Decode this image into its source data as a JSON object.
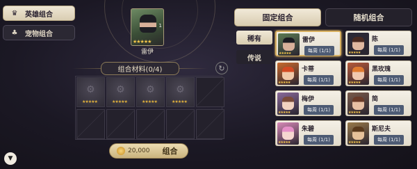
{
  "sidebar": {
    "items": [
      {
        "label": "英雄组合",
        "icon": "crown-icon",
        "glyph": "♛"
      },
      {
        "label": "宠物组合",
        "icon": "paw-icon",
        "glyph": "♣"
      }
    ]
  },
  "filter": {
    "icon": "filter-icon",
    "glyph": "▼"
  },
  "center": {
    "hero": {
      "name": "雷伊",
      "level": "1"
    },
    "materials_label": "组合材料(0/4)",
    "refresh_glyph": "↻",
    "slots": [
      {
        "state": "filled"
      },
      {
        "state": "filled"
      },
      {
        "state": "filled"
      },
      {
        "state": "filled"
      },
      {
        "state": "empty"
      },
      {
        "state": "empty"
      },
      {
        "state": "empty"
      },
      {
        "state": "empty"
      },
      {
        "state": "empty"
      },
      {
        "state": "empty"
      }
    ],
    "cost": "20,000",
    "combine_label": "组合"
  },
  "right": {
    "tabs": [
      {
        "label": "固定组合",
        "active": true
      },
      {
        "label": "随机组合",
        "active": false
      }
    ],
    "rarities": [
      {
        "label": "稀有",
        "active": true
      },
      {
        "label": "传说",
        "active": false
      }
    ],
    "heroes": [
      {
        "name": "雷伊",
        "badge": "每周 (1/1)",
        "selected": true,
        "bg": "#5c7a52",
        "skin": "#d8b09a",
        "hair": "#1c1c22"
      },
      {
        "name": "陈",
        "badge": "每周 (1/1)",
        "selected": false,
        "bg": "#2c2a36",
        "skin": "#e0b8a0",
        "hair": "#4a2a20"
      },
      {
        "name": "卡蒂",
        "badge": "每周 (1/1)",
        "selected": false,
        "bg": "#c86a2e",
        "skin": "#f0c8a8",
        "hair": "#d24a22"
      },
      {
        "name": "黑玫瑰",
        "badge": "每周 (1/1)",
        "selected": false,
        "bg": "#b85a3a",
        "skin": "#f0c8b0",
        "hair": "#e07a30"
      },
      {
        "name": "梅伊",
        "badge": "每周 (1/1)",
        "selected": false,
        "bg": "#8a6a9a",
        "skin": "#f2d2c0",
        "hair": "#7a4a3a"
      },
      {
        "name": "简",
        "badge": "每周 (1/1)",
        "selected": false,
        "bg": "#7a5a4a",
        "skin": "#e8c0a4",
        "hair": "#6a3a28"
      },
      {
        "name": "朱碧",
        "badge": "每周 (1/1)",
        "selected": false,
        "bg": "#d88ab8",
        "skin": "#f6d6d0",
        "hair": "#e690c8"
      },
      {
        "name": "斯尼夫",
        "badge": "每周 (1/1)",
        "selected": false,
        "bg": "#9a7a4a",
        "skin": "#e6c29a",
        "hair": "#5a3a1c"
      }
    ]
  }
}
